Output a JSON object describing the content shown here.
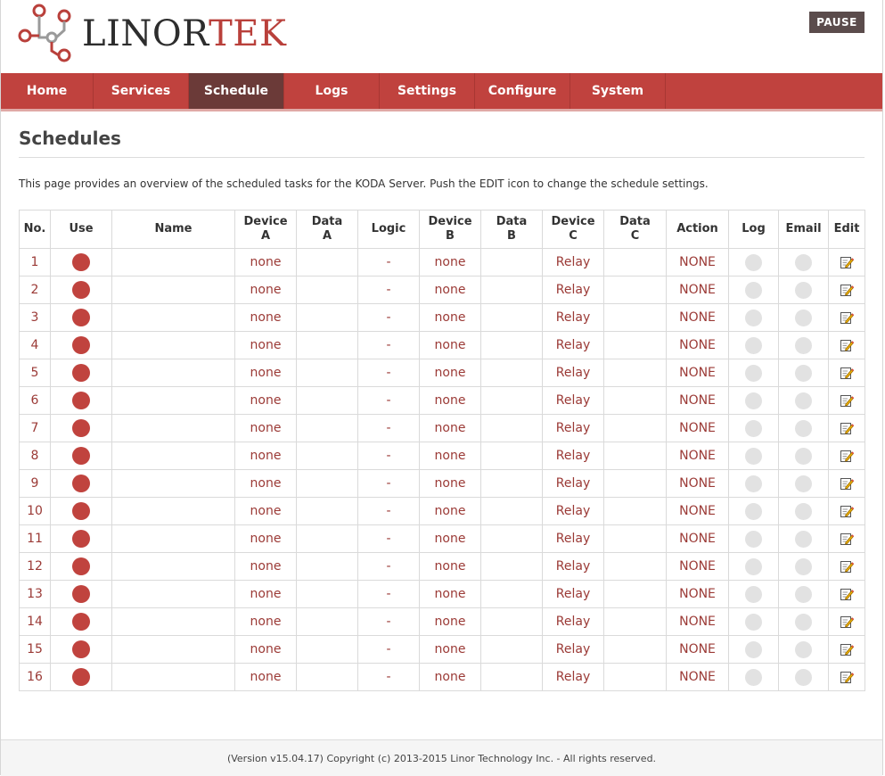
{
  "header": {
    "logo_text_a": "LINOR",
    "logo_text_b": "TEK",
    "pause_label": "PAUSE"
  },
  "nav": {
    "items": [
      {
        "label": "Home"
      },
      {
        "label": "Services"
      },
      {
        "label": "Schedule"
      },
      {
        "label": "Logs"
      },
      {
        "label": "Settings"
      },
      {
        "label": "Configure"
      },
      {
        "label": "System"
      }
    ],
    "active": "Schedule"
  },
  "page": {
    "title": "Schedules",
    "description": "This page provides an overview of the scheduled tasks for the KODA Server. Push the EDIT icon to change the schedule settings."
  },
  "table": {
    "columns": [
      "No.",
      "Use",
      "Name",
      "Device\nA",
      "Data\nA",
      "Logic",
      "Device\nB",
      "Data\nB",
      "Device\nC",
      "Data\nC",
      "Action",
      "Log",
      "Email",
      "Edit"
    ],
    "rows": [
      {
        "no": "1",
        "name": "",
        "device_a": "none",
        "data_a": "",
        "logic": "-",
        "device_b": "none",
        "data_b": "",
        "device_c": "Relay",
        "data_c": "",
        "action": "NONE"
      },
      {
        "no": "2",
        "name": "",
        "device_a": "none",
        "data_a": "",
        "logic": "-",
        "device_b": "none",
        "data_b": "",
        "device_c": "Relay",
        "data_c": "",
        "action": "NONE"
      },
      {
        "no": "3",
        "name": "",
        "device_a": "none",
        "data_a": "",
        "logic": "-",
        "device_b": "none",
        "data_b": "",
        "device_c": "Relay",
        "data_c": "",
        "action": "NONE"
      },
      {
        "no": "4",
        "name": "",
        "device_a": "none",
        "data_a": "",
        "logic": "-",
        "device_b": "none",
        "data_b": "",
        "device_c": "Relay",
        "data_c": "",
        "action": "NONE"
      },
      {
        "no": "5",
        "name": "",
        "device_a": "none",
        "data_a": "",
        "logic": "-",
        "device_b": "none",
        "data_b": "",
        "device_c": "Relay",
        "data_c": "",
        "action": "NONE"
      },
      {
        "no": "6",
        "name": "",
        "device_a": "none",
        "data_a": "",
        "logic": "-",
        "device_b": "none",
        "data_b": "",
        "device_c": "Relay",
        "data_c": "",
        "action": "NONE"
      },
      {
        "no": "7",
        "name": "",
        "device_a": "none",
        "data_a": "",
        "logic": "-",
        "device_b": "none",
        "data_b": "",
        "device_c": "Relay",
        "data_c": "",
        "action": "NONE"
      },
      {
        "no": "8",
        "name": "",
        "device_a": "none",
        "data_a": "",
        "logic": "-",
        "device_b": "none",
        "data_b": "",
        "device_c": "Relay",
        "data_c": "",
        "action": "NONE"
      },
      {
        "no": "9",
        "name": "",
        "device_a": "none",
        "data_a": "",
        "logic": "-",
        "device_b": "none",
        "data_b": "",
        "device_c": "Relay",
        "data_c": "",
        "action": "NONE"
      },
      {
        "no": "10",
        "name": "",
        "device_a": "none",
        "data_a": "",
        "logic": "-",
        "device_b": "none",
        "data_b": "",
        "device_c": "Relay",
        "data_c": "",
        "action": "NONE"
      },
      {
        "no": "11",
        "name": "",
        "device_a": "none",
        "data_a": "",
        "logic": "-",
        "device_b": "none",
        "data_b": "",
        "device_c": "Relay",
        "data_c": "",
        "action": "NONE"
      },
      {
        "no": "12",
        "name": "",
        "device_a": "none",
        "data_a": "",
        "logic": "-",
        "device_b": "none",
        "data_b": "",
        "device_c": "Relay",
        "data_c": "",
        "action": "NONE"
      },
      {
        "no": "13",
        "name": "",
        "device_a": "none",
        "data_a": "",
        "logic": "-",
        "device_b": "none",
        "data_b": "",
        "device_c": "Relay",
        "data_c": "",
        "action": "NONE"
      },
      {
        "no": "14",
        "name": "",
        "device_a": "none",
        "data_a": "",
        "logic": "-",
        "device_b": "none",
        "data_b": "",
        "device_c": "Relay",
        "data_c": "",
        "action": "NONE"
      },
      {
        "no": "15",
        "name": "",
        "device_a": "none",
        "data_a": "",
        "logic": "-",
        "device_b": "none",
        "data_b": "",
        "device_c": "Relay",
        "data_c": "",
        "action": "NONE"
      },
      {
        "no": "16",
        "name": "",
        "device_a": "none",
        "data_a": "",
        "logic": "-",
        "device_b": "none",
        "data_b": "",
        "device_c": "Relay",
        "data_c": "",
        "action": "NONE"
      }
    ],
    "icons": {
      "use": "status-dot-icon",
      "log": "status-dot-icon",
      "email": "status-dot-icon",
      "edit": "edit-icon"
    }
  },
  "footer": {
    "text": "(Version v15.04.17) Copyright (c) 2013-2015 Linor Technology Inc. - All rights reserved."
  },
  "colors": {
    "brand_red": "#c0423e",
    "nav_active": "#6b3a38",
    "pause_bg": "#5b4c4c",
    "cell_text": "#9b3a36",
    "dot_inactive": "#e2e2e2"
  }
}
